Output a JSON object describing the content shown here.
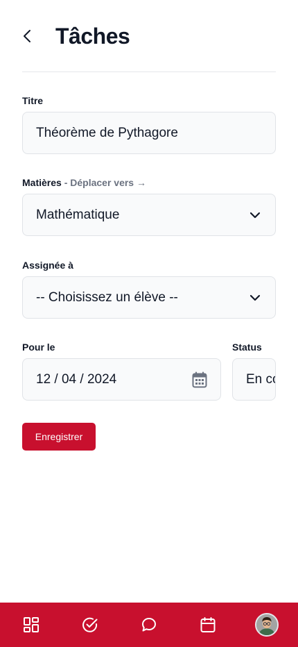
{
  "header": {
    "title": "Tâches"
  },
  "form": {
    "title": {
      "label": "Titre",
      "value": "Théorème de Pythagore"
    },
    "subject": {
      "label": "Matières",
      "move_link": "- Déplacer vers →",
      "value": "Mathématique"
    },
    "assigned": {
      "label": "Assignée à",
      "value": "-- Choisissez un élève --"
    },
    "due": {
      "label": "Pour le",
      "value": "12 / 04 / 2024"
    },
    "status": {
      "label": "Status",
      "value": "En co"
    },
    "save_label": "Enregistrer"
  },
  "nav": {
    "items": [
      {
        "icon": "grid-icon"
      },
      {
        "icon": "check-circle-icon"
      },
      {
        "icon": "chat-bubble-icon"
      },
      {
        "icon": "calendar-icon"
      },
      {
        "icon": "avatar"
      }
    ]
  },
  "colors": {
    "accent": "#c8102e",
    "field_bg": "#f9fafb",
    "border": "#e0e3e7",
    "text": "#111827",
    "muted": "#6b7280"
  }
}
